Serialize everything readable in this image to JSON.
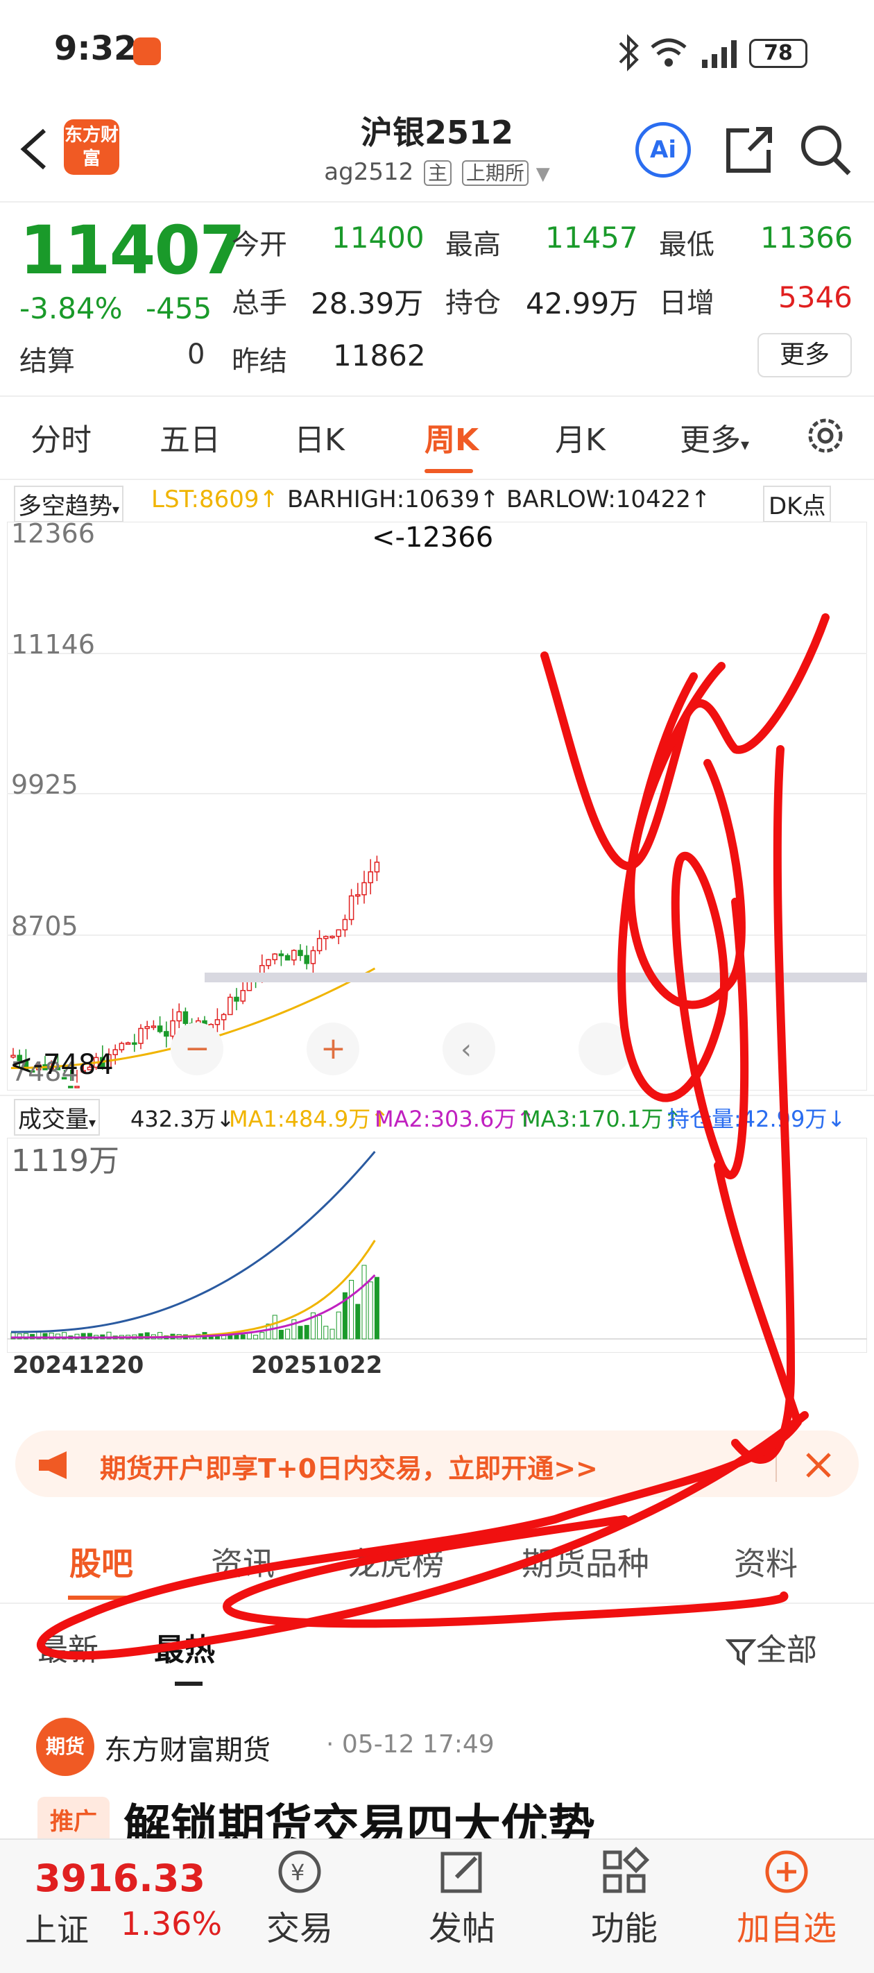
{
  "status_bar": {
    "time": "9:32",
    "battery": "78"
  },
  "header": {
    "logo_text": "东方财富",
    "title": "沪银2512",
    "code": "ag2512",
    "tag_main": "主",
    "exchange": "上期所",
    "ai_label": "Ai"
  },
  "quote": {
    "last_price": "11407",
    "change_pct": "-3.84%",
    "change": "-455",
    "settle_label": "结算",
    "settle_value": "0",
    "open_label": "今开",
    "open_value": "11400",
    "high_label": "最高",
    "high_value": "11457",
    "low_label": "最低",
    "low_value": "11366",
    "volume_label": "总手",
    "volume_value": "28.39万",
    "oi_label": "持仓",
    "oi_value": "42.99万",
    "oi_change_label": "日增",
    "oi_change_value": "5346",
    "prev_settle_label": "昨结",
    "prev_settle_value": "11862",
    "more_label": "更多"
  },
  "period_tabs": [
    "分时",
    "五日",
    "日K",
    "周K",
    "月K",
    "更多"
  ],
  "active_period": "周K",
  "indicator": {
    "name": "多空趋势",
    "lst": "LST:8609",
    "barhigh": "BARHIGH:10639",
    "barlow": "BARLOW:10422",
    "dk_label": "DK点"
  },
  "chart_data": {
    "type": "candlestick",
    "y_ticks": [
      "12366",
      "11146",
      "9925",
      "8705",
      "7484"
    ],
    "ylim": [
      7484,
      12366
    ],
    "max_annotation": "<-12366",
    "min_annotation": "<-7484",
    "x_labels": [
      "20241220",
      "20251022"
    ],
    "volume_label": "成交量",
    "volume_value": "432.3万",
    "ma1": "MA1:484.9万",
    "ma2": "MA2:303.6万",
    "ma3": "MA3:170.1万",
    "oi": "持仓量:42.99万",
    "volume_max_tick": "1119万",
    "colors": {
      "up": "#e02020",
      "down": "#1a9a2a",
      "ma": "#f0b400",
      "oi": "#2a5aa0"
    }
  },
  "promo": {
    "text": "期货开户即享T+0日内交易，立即开通>>"
  },
  "content_tabs": [
    "股吧",
    "资讯",
    "龙虎榜",
    "期货品种",
    "资料"
  ],
  "sub_tabs": [
    "最新",
    "最热"
  ],
  "filter_label": "全部",
  "post": {
    "avatar_text": "期货",
    "author": "东方财富期货",
    "time": "· 05-12 17:49",
    "tag": "推广",
    "title": "解锁期货交易四大优势"
  },
  "bottom_bar": {
    "index_value": "3916.33",
    "index_name": "上证",
    "index_change": "1.36%",
    "nav": [
      "交易",
      "发帖",
      "功能",
      "加自选"
    ]
  }
}
